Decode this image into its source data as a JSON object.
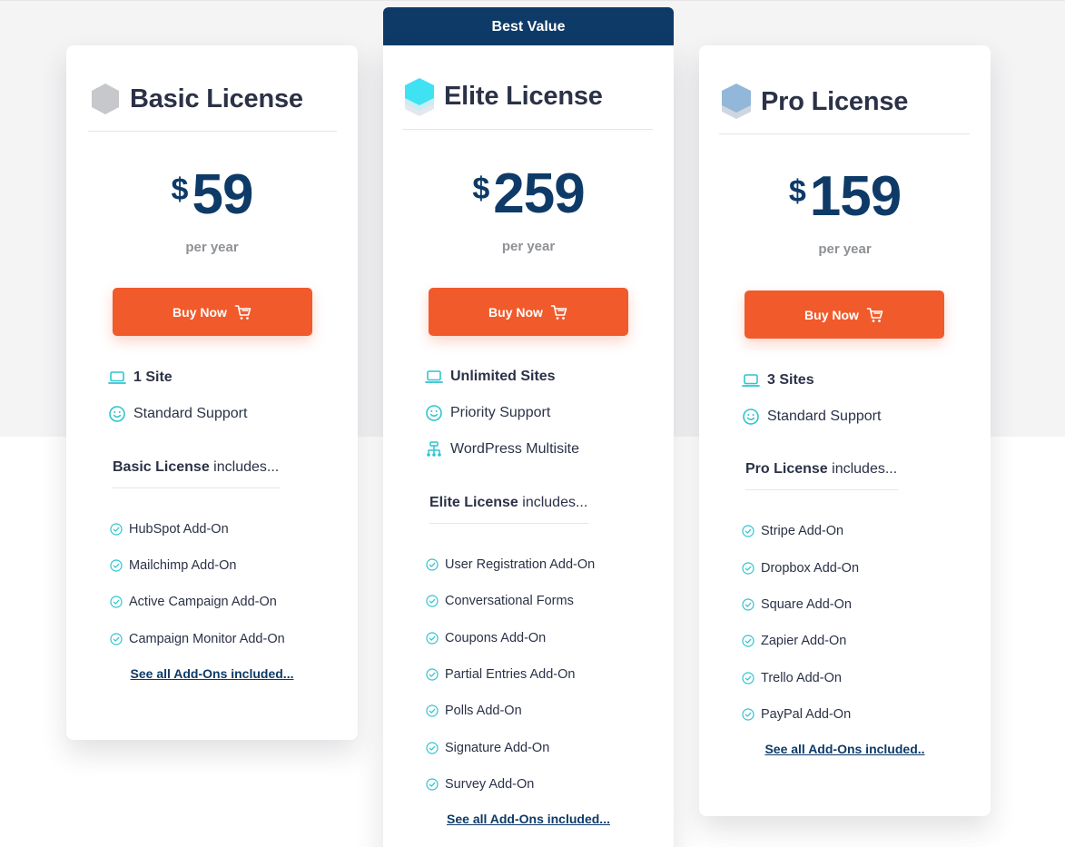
{
  "badge": {
    "label": "Best Value"
  },
  "colors": {
    "accent": "#f15a2b",
    "brand": "#0e3a68",
    "check": "#2ec4d0"
  },
  "plans": [
    {
      "id": "basic",
      "title": "Basic License",
      "currency": "$",
      "price": "59",
      "period": "per year",
      "cta": "Buy Now",
      "icon": "hexagon-gray-icon",
      "features": [
        {
          "icon": "laptop-icon",
          "label": "1 Site"
        },
        {
          "icon": "smiley-icon",
          "label": "Standard Support"
        }
      ],
      "includes_bold": "Basic License",
      "includes_rest": " includes...",
      "addons": [
        "HubSpot Add-On",
        "Mailchimp Add-On",
        "Active Campaign Add-On",
        "Campaign Monitor Add-On"
      ],
      "see_all": "See all Add-Ons included..."
    },
    {
      "id": "elite",
      "title": "Elite License",
      "currency": "$",
      "price": "259",
      "period": "per year",
      "cta": "Buy Now",
      "icon": "hexagon-stack-cyan-icon",
      "features": [
        {
          "icon": "laptop-icon",
          "label": "Unlimited Sites"
        },
        {
          "icon": "smiley-icon",
          "label": "Priority Support"
        },
        {
          "icon": "network-icon",
          "label": "WordPress Multisite"
        }
      ],
      "includes_bold": "Elite License",
      "includes_rest": " includes...",
      "addons": [
        "User Registration Add-On",
        "Conversational Forms",
        "Coupons Add-On",
        "Partial Entries Add-On",
        "Polls Add-On",
        "Signature Add-On",
        "Survey Add-On"
      ],
      "see_all": "See all Add-Ons included..."
    },
    {
      "id": "pro",
      "title": "Pro License",
      "currency": "$",
      "price": "159",
      "period": "per year",
      "cta": "Buy Now",
      "icon": "hexagon-stack-blue-icon",
      "features": [
        {
          "icon": "laptop-icon",
          "label": "3 Sites"
        },
        {
          "icon": "smiley-icon",
          "label": "Standard Support"
        }
      ],
      "includes_bold": "Pro License",
      "includes_rest": " includes...",
      "addons": [
        "Stripe Add-On",
        "Dropbox Add-On",
        "Square Add-On",
        "Zapier Add-On",
        "Trello Add-On",
        "PayPal Add-On"
      ],
      "see_all": "See all Add-Ons included.."
    }
  ]
}
